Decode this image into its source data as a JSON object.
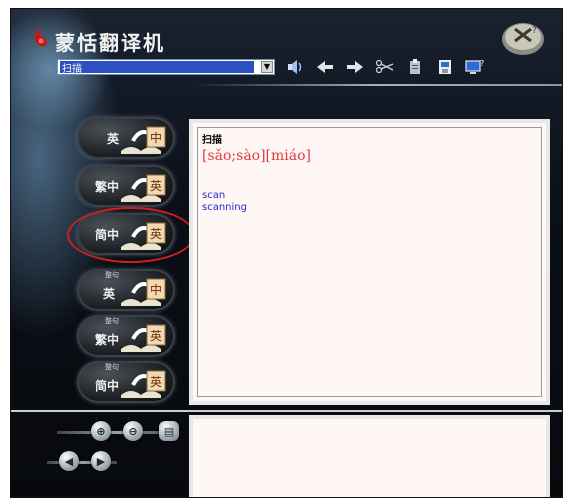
{
  "app": {
    "title": "蒙恬翻译机"
  },
  "search": {
    "value": "扫描"
  },
  "toolbar": {
    "icons": [
      "speaker-icon",
      "back-arrow-icon",
      "forward-arrow-icon",
      "scissors-icon",
      "clipboard-icon",
      "save-icon",
      "help-monitor-icon"
    ]
  },
  "modes": [
    {
      "label": "英",
      "tiny": "",
      "target": "中"
    },
    {
      "label": "繁中",
      "tiny": "",
      "target": "英"
    },
    {
      "label": "简中",
      "tiny": "",
      "target": "英"
    },
    {
      "label": "英",
      "tiny": "整句",
      "target": "中"
    },
    {
      "label": "繁中",
      "tiny": "整句",
      "target": "英"
    },
    {
      "label": "简中",
      "tiny": "整句",
      "target": "英"
    }
  ],
  "result": {
    "word": "扫描",
    "phonetic": "[sǎo;sào][miáo]",
    "definitions": [
      "scan",
      "scanning"
    ]
  },
  "colors": {
    "accent_red": "#d11e1e",
    "phonetic_red": "#e23b3b",
    "definition_blue": "#2828c8"
  }
}
